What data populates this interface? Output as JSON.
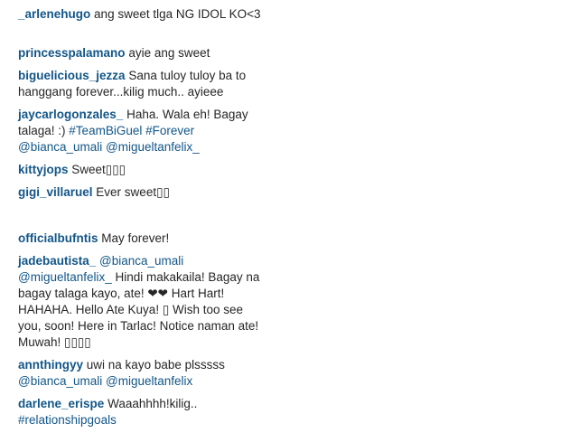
{
  "comments": [
    {
      "user": "_arlenehugo",
      "parts": [
        {
          "t": "ang sweet tlga NG IDOL KO<3"
        }
      ]
    },
    {
      "user": "princesspalamano",
      "parts": [
        {
          "t": "ayie ang sweet"
        }
      ]
    },
    {
      "user": "biguelicious_jezza",
      "parts": [
        {
          "t": "Sana tuloy tuloy ba to hanggang forever...kilig much.. ayieee"
        }
      ]
    },
    {
      "user": "jaycarlogonzales_",
      "parts": [
        {
          "t": "Haha. Wala eh! Bagay talaga! :)"
        },
        {
          "link": "#TeamBiGuel"
        },
        {
          "link": "#Forever"
        },
        {
          "link": "@bianca_umali"
        },
        {
          "link": "@migueltanfelix_"
        }
      ]
    },
    {
      "user": "kittyjops",
      "parts": [
        {
          "t": "Sweet▯▯▯"
        }
      ]
    },
    {
      "user": "gigi_villaruel",
      "parts": [
        {
          "t": "Ever sweet▯▯"
        }
      ]
    },
    {
      "user": "officialbufntis",
      "parts": [
        {
          "t": "May forever!"
        }
      ]
    },
    {
      "user": "jadebautista_",
      "parts": [
        {
          "link": "@bianca_umali"
        },
        {
          "link": "@migueltanfelix_"
        },
        {
          "t": "Hindi makakaila! Bagay na bagay talaga kayo, ate! ❤❤ Hart Hart! HAHAHA. Hello Ate Kuya! ▯ Wish too see you, soon! Here in Tarlac! Notice naman ate! Muwah! ▯▯▯▯"
        }
      ]
    },
    {
      "user": "annthingyy",
      "parts": [
        {
          "t": "uwi na kayo babe plsssss"
        },
        {
          "link": "@bianca_umali"
        },
        {
          "link": "@migueltanfelix"
        }
      ]
    },
    {
      "user": "darlene_erispe",
      "parts": [
        {
          "t": "Waaahhhh!kilig.."
        },
        {
          "link": "#relationshipgoals"
        }
      ]
    }
  ]
}
